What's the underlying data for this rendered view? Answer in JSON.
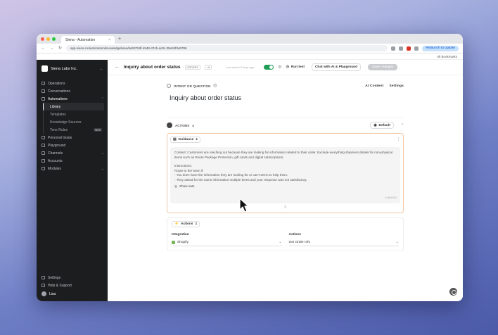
{
  "browser": {
    "tab_title": "Siena - Automation",
    "url": "app.siena.cx/automation/knowledgebase/6e5370df-4948-47cb-ac8c-35e34f3e5786",
    "relaunch_label": "Relaunch to update",
    "bookmarks_label": "All Bookmarks"
  },
  "sidebar": {
    "org_name": "Siena Labs Inc.",
    "items": [
      {
        "label": "Operations"
      },
      {
        "label": "Conversations"
      },
      {
        "label": "Automations"
      },
      {
        "label": "Library"
      },
      {
        "label": "Templates"
      },
      {
        "label": "Knowledge Sources"
      },
      {
        "label": "Tone Rules",
        "badge": "NEW"
      },
      {
        "label": "Personal Goals"
      },
      {
        "label": "Playground"
      },
      {
        "label": "Channels"
      },
      {
        "label": "Accounts"
      },
      {
        "label": "Modules"
      }
    ],
    "bottom": [
      {
        "label": "Settings"
      },
      {
        "label": "Help & Support"
      }
    ],
    "user": "Lisa"
  },
  "topbar": {
    "title": "Inquiry about order status",
    "pill_text": "ORDERS",
    "pill_count": "+8",
    "last_saved": "Last saved 3 days ago",
    "run_test": "Run test",
    "chat_btn": "Chat with AI & Playground",
    "save_btn": "Save changes"
  },
  "intent": {
    "label": "INTENT OR QUESTION",
    "ai_content": "AI Content",
    "settings": "Settings",
    "question": "Inquiry about order status"
  },
  "actions": {
    "label": "ACTIONS",
    "count": "4",
    "default_btn": "Default"
  },
  "guidance": {
    "tab_label": "Guidance",
    "tab_count": "1",
    "context": "Context: Customers are reaching out because they are looking for information related to their order. Exclude everything shipment details for non-physical items such as Route Package Protection, gift cards and digital subscriptions.",
    "instructions_title": "Instructions:",
    "line1": "Route to the team if:",
    "line2": "- You don't have the information they are looking for or can't seem to help them.",
    "line3": "- They asked for the same information multiple times and your response was not satisfactory.",
    "show_vars": "Show vars",
    "char_count": "448/5000"
  },
  "actions_card": {
    "tab_label": "Actions",
    "tab_count": "1",
    "integration_label": "Integration",
    "integration_value": "Shopify",
    "actions_label": "Actions",
    "actions_value": "Get Order Info"
  },
  "colors": {
    "sidebar_bg": "#1c1d1f",
    "toggle_on": "#1f9d55",
    "card_border_active": "#f0c8a8",
    "shopify": "#7ab55c"
  }
}
